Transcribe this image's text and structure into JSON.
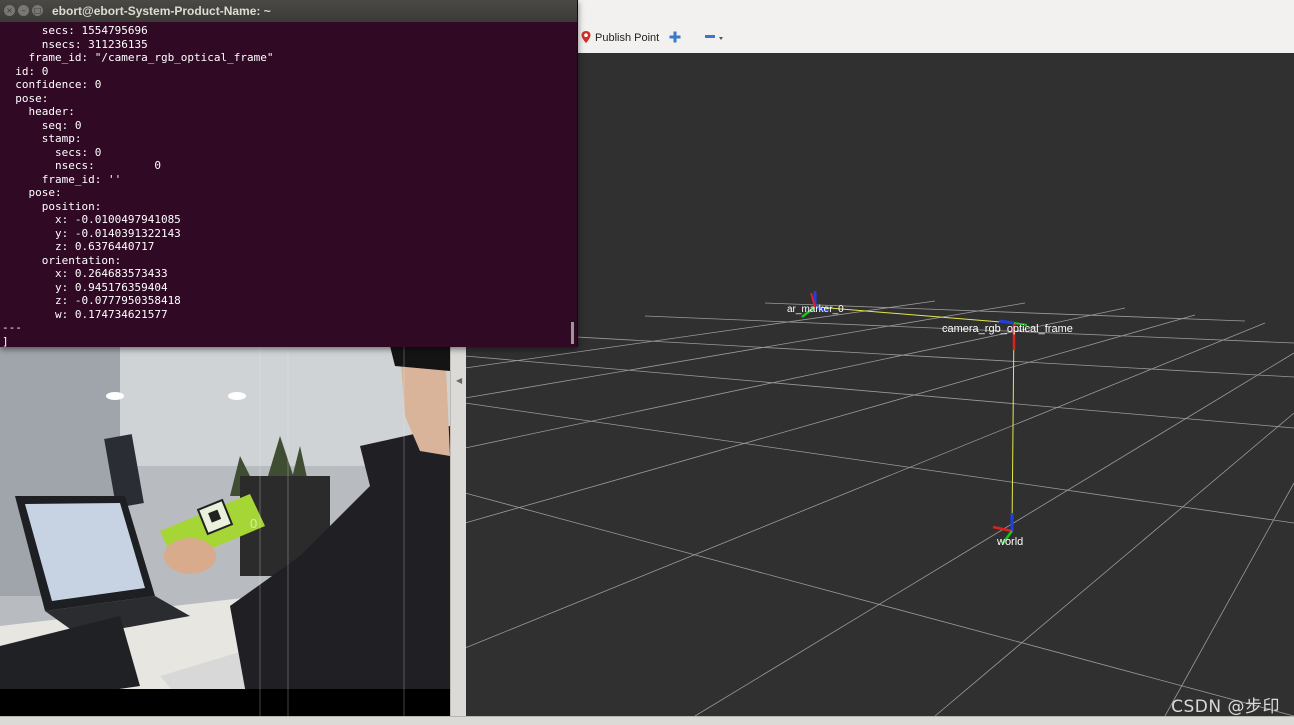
{
  "terminal": {
    "title": "ebort@ebort-System-Product-Name: ~",
    "lines": [
      "      secs: 1554795696",
      "      nsecs: 311236135",
      "    frame_id: \"/camera_rgb_optical_frame\"",
      "  id: 0",
      "  confidence: 0",
      "  pose:",
      "    header:",
      "      seq: 0",
      "      stamp:",
      "        secs: 0",
      "        nsecs:         0",
      "      frame_id: ''",
      "    pose:",
      "      position:",
      "        x: -0.0100497941085",
      "        y: -0.0140391322143",
      "        z: 0.6376440717",
      "      orientation:",
      "        x: 0.264683573433",
      "        y: 0.945176359404",
      "        z: -0.0777950358418",
      "        w: 0.174734621577",
      "---",
      "]"
    ]
  },
  "rviz": {
    "toolbar": {
      "publish_point": "Publish Point",
      "interact_icon": "plus-move-icon",
      "minus_icon": "minus-dropdown-icon"
    },
    "frames": {
      "marker": "ar_marker_0",
      "camera": "camera_rgb_optical_frame",
      "world": "world"
    },
    "colors": {
      "grid": "#a0a0a0",
      "background": "#303030",
      "link": "#e6e64c",
      "axis_x": "#e02020",
      "axis_y": "#20c020",
      "axis_z": "#2040e0"
    }
  },
  "camera": {
    "overlay_label": "0"
  },
  "watermark": "CSDN @步印"
}
